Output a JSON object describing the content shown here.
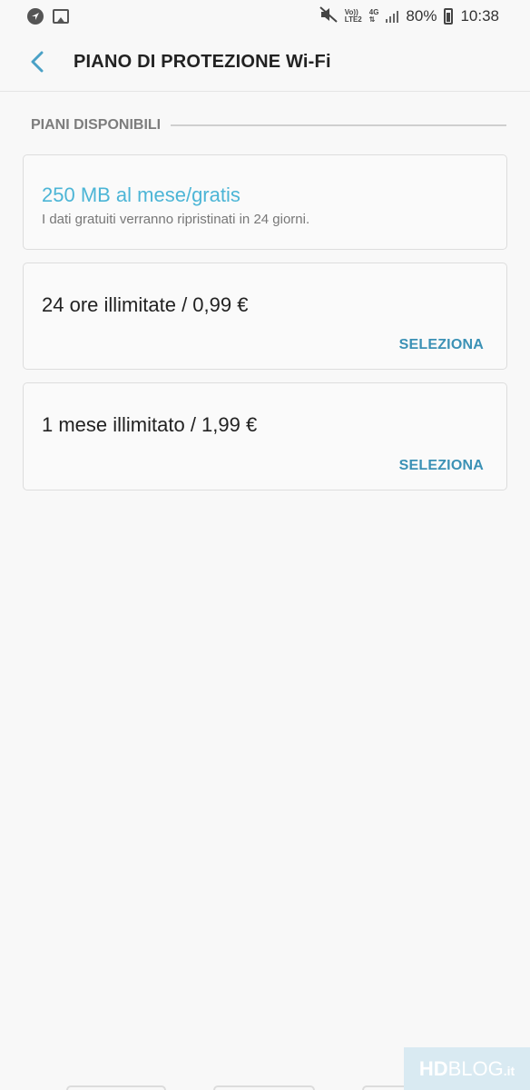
{
  "status_bar": {
    "lte_top": "Vo))",
    "lte_bottom": "LTE2",
    "network": "4G",
    "battery": "80%",
    "time": "10:38",
    "icons": [
      "navigation-icon",
      "gallery-icon",
      "mute-icon",
      "signal-icon",
      "battery-icon"
    ]
  },
  "app_bar": {
    "title": "PIANO DI PROTEZIONE Wi-Fi",
    "back_icon": "back-arrow-icon"
  },
  "section": {
    "title": "PIANI DISPONIBILI"
  },
  "plans": [
    {
      "title": "250 MB al mese/gratis",
      "subtitle": "I dati gratuiti verranno ripristinati in 24 giorni."
    },
    {
      "title": "24 ore illimitate / 0,99 €",
      "button": "SELEZIONA"
    },
    {
      "title": "1 mese illimitato / 1,99 €",
      "button": "SELEZIONA"
    }
  ],
  "watermark": {
    "brand": "HD",
    "word": "BLOG",
    "suffix": ".it"
  },
  "colors": {
    "accent": "#3b91b5",
    "free_plan": "#4cb5d6",
    "background": "#f8f8f8"
  }
}
